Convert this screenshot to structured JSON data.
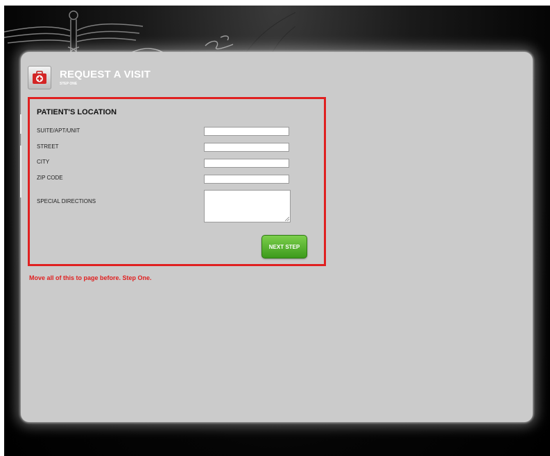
{
  "header": {
    "title": "REQUEST A VISIT",
    "subtitle": "STEP ONE",
    "icon": "medical-kit-icon"
  },
  "form": {
    "heading": "PATIENT'S LOCATION",
    "fields": {
      "suite": {
        "label": "SUITE/APT/UNIT",
        "value": ""
      },
      "street": {
        "label": "STREET",
        "value": ""
      },
      "city": {
        "label": "CITY",
        "value": ""
      },
      "zip": {
        "label": "ZIP CODE",
        "value": ""
      },
      "directions": {
        "label": "SPECIAL DIRECTIONS",
        "value": ""
      }
    },
    "next_label": "NEXT STEP"
  },
  "annotation": {
    "note": "Move all of this to page before. Step One."
  },
  "colors": {
    "highlight": "#e02020",
    "button_green": "#4caf2a",
    "panel": "#cbcbcb",
    "backdrop": "#000000"
  }
}
